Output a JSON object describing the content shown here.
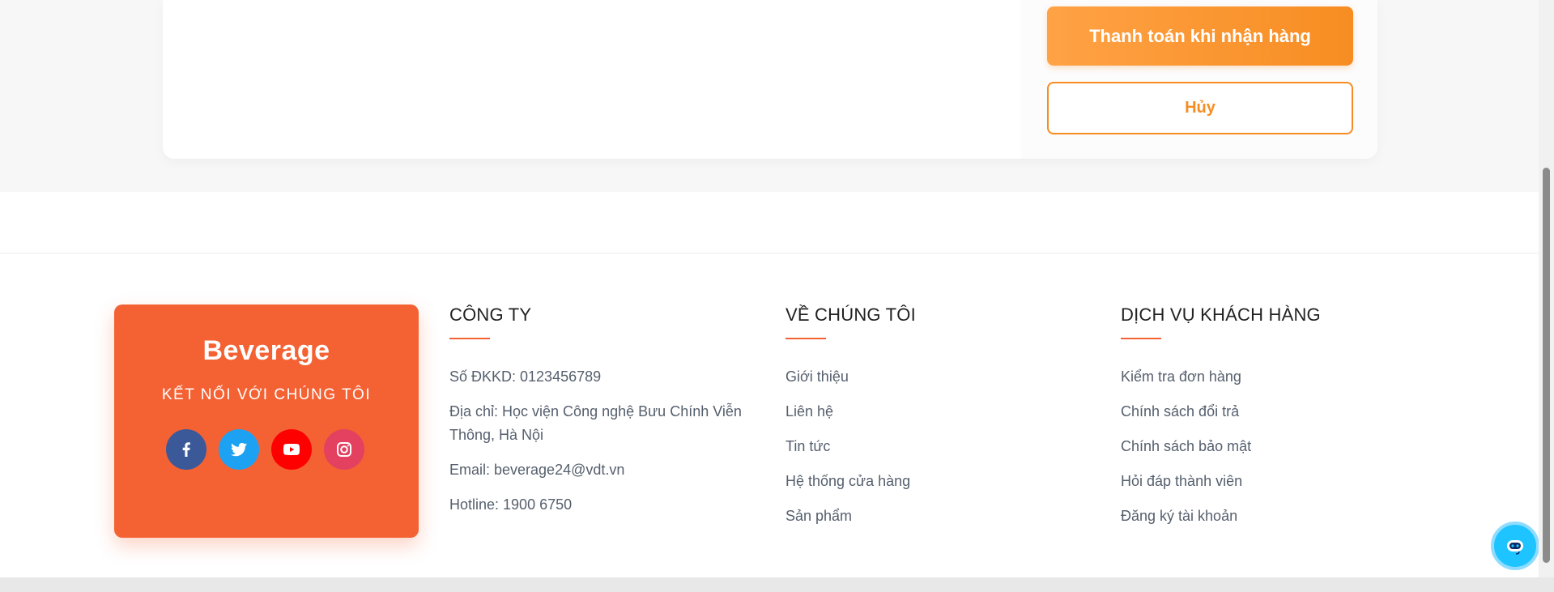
{
  "checkout": {
    "cod_button": "Thanh toán khi nhận hàng",
    "cancel_button": "Hủy"
  },
  "brand": {
    "name": "Beverage",
    "tagline": "KẾT NỐI VỚI CHÚNG TÔI",
    "socials": [
      "facebook-icon",
      "twitter-icon",
      "youtube-icon",
      "instagram-icon"
    ]
  },
  "company": {
    "title": "CÔNG TY",
    "items": [
      "Số ĐKKD: 0123456789",
      "Địa chỉ: Học viện Công nghệ Bưu Chính Viễn Thông, Hà Nội",
      "Email: beverage24@vdt.vn",
      "Hotline: 1900 6750"
    ]
  },
  "about": {
    "title": "VỀ CHÚNG TÔI",
    "items": [
      "Giới thiệu",
      "Liên hệ",
      "Tin tức",
      "Hệ thống cửa hàng",
      "Sản phẩm"
    ]
  },
  "service": {
    "title": "DỊCH VỤ KHÁCH HÀNG",
    "items": [
      "Kiểm tra đơn hàng",
      "Chính sách đổi trả",
      "Chính sách bảo mật",
      "Hỏi đáp thành viên",
      "Đăng ký tài khoản"
    ]
  },
  "colors": {
    "accent": "#f78d22",
    "brand_box": "#f46234",
    "chat": "#1ec4ff"
  }
}
